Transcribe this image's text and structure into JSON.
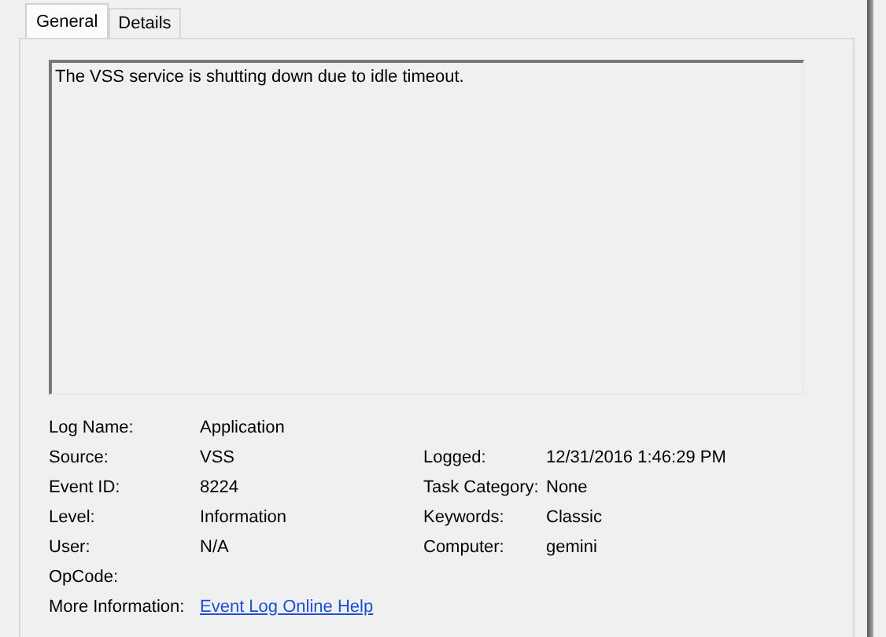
{
  "tabs": [
    {
      "label": "General",
      "selected": true
    },
    {
      "label": "Details",
      "selected": false
    }
  ],
  "description": "The VSS service is shutting down due to idle timeout.",
  "fields": [
    {
      "label": "Log Name:",
      "value": "Application"
    },
    {
      "label": "Source:",
      "value": "VSS",
      "label_2": "Logged:",
      "value_2": "12/31/2016 1:46:29 PM"
    },
    {
      "label": "Event ID:",
      "value": "8224",
      "label_2": "Task Category:",
      "value_2": "None"
    },
    {
      "label": "Level:",
      "value": "Information",
      "label_2": "Keywords:",
      "value_2": "Classic"
    },
    {
      "label": "User:",
      "value": "N/A",
      "label_2": "Computer:",
      "value_2": "gemini"
    },
    {
      "label": "OpCode:"
    },
    {
      "label": "More Information:",
      "link": "Event Log Online Help"
    }
  ]
}
